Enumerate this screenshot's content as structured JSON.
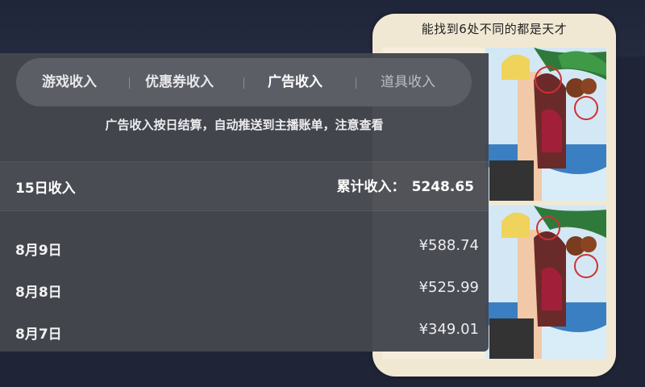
{
  "game": {
    "title": "能找到6处不同的都是天才"
  },
  "tabs": [
    {
      "label": "游戏收入",
      "active": false
    },
    {
      "label": "优惠券收入",
      "active": false
    },
    {
      "label": "广告收入",
      "active": true
    },
    {
      "label": "道具收入",
      "active": false
    }
  ],
  "notice": "广告收入按日结算，自动推送到主播账单，注意查看",
  "summary": {
    "label": "15日收入",
    "total_caption": "累计收入：",
    "total_value": "5248.65"
  },
  "days": [
    {
      "date": "8月9日",
      "amount": "¥588.74"
    },
    {
      "date": "8月8日",
      "amount": "¥525.99"
    },
    {
      "date": "8月7日",
      "amount": "¥349.01"
    }
  ],
  "colors": {
    "overlay": "#44464e",
    "tabbar": "#5c5e66",
    "background": "#1f2537",
    "card": "#f1e8d4"
  }
}
